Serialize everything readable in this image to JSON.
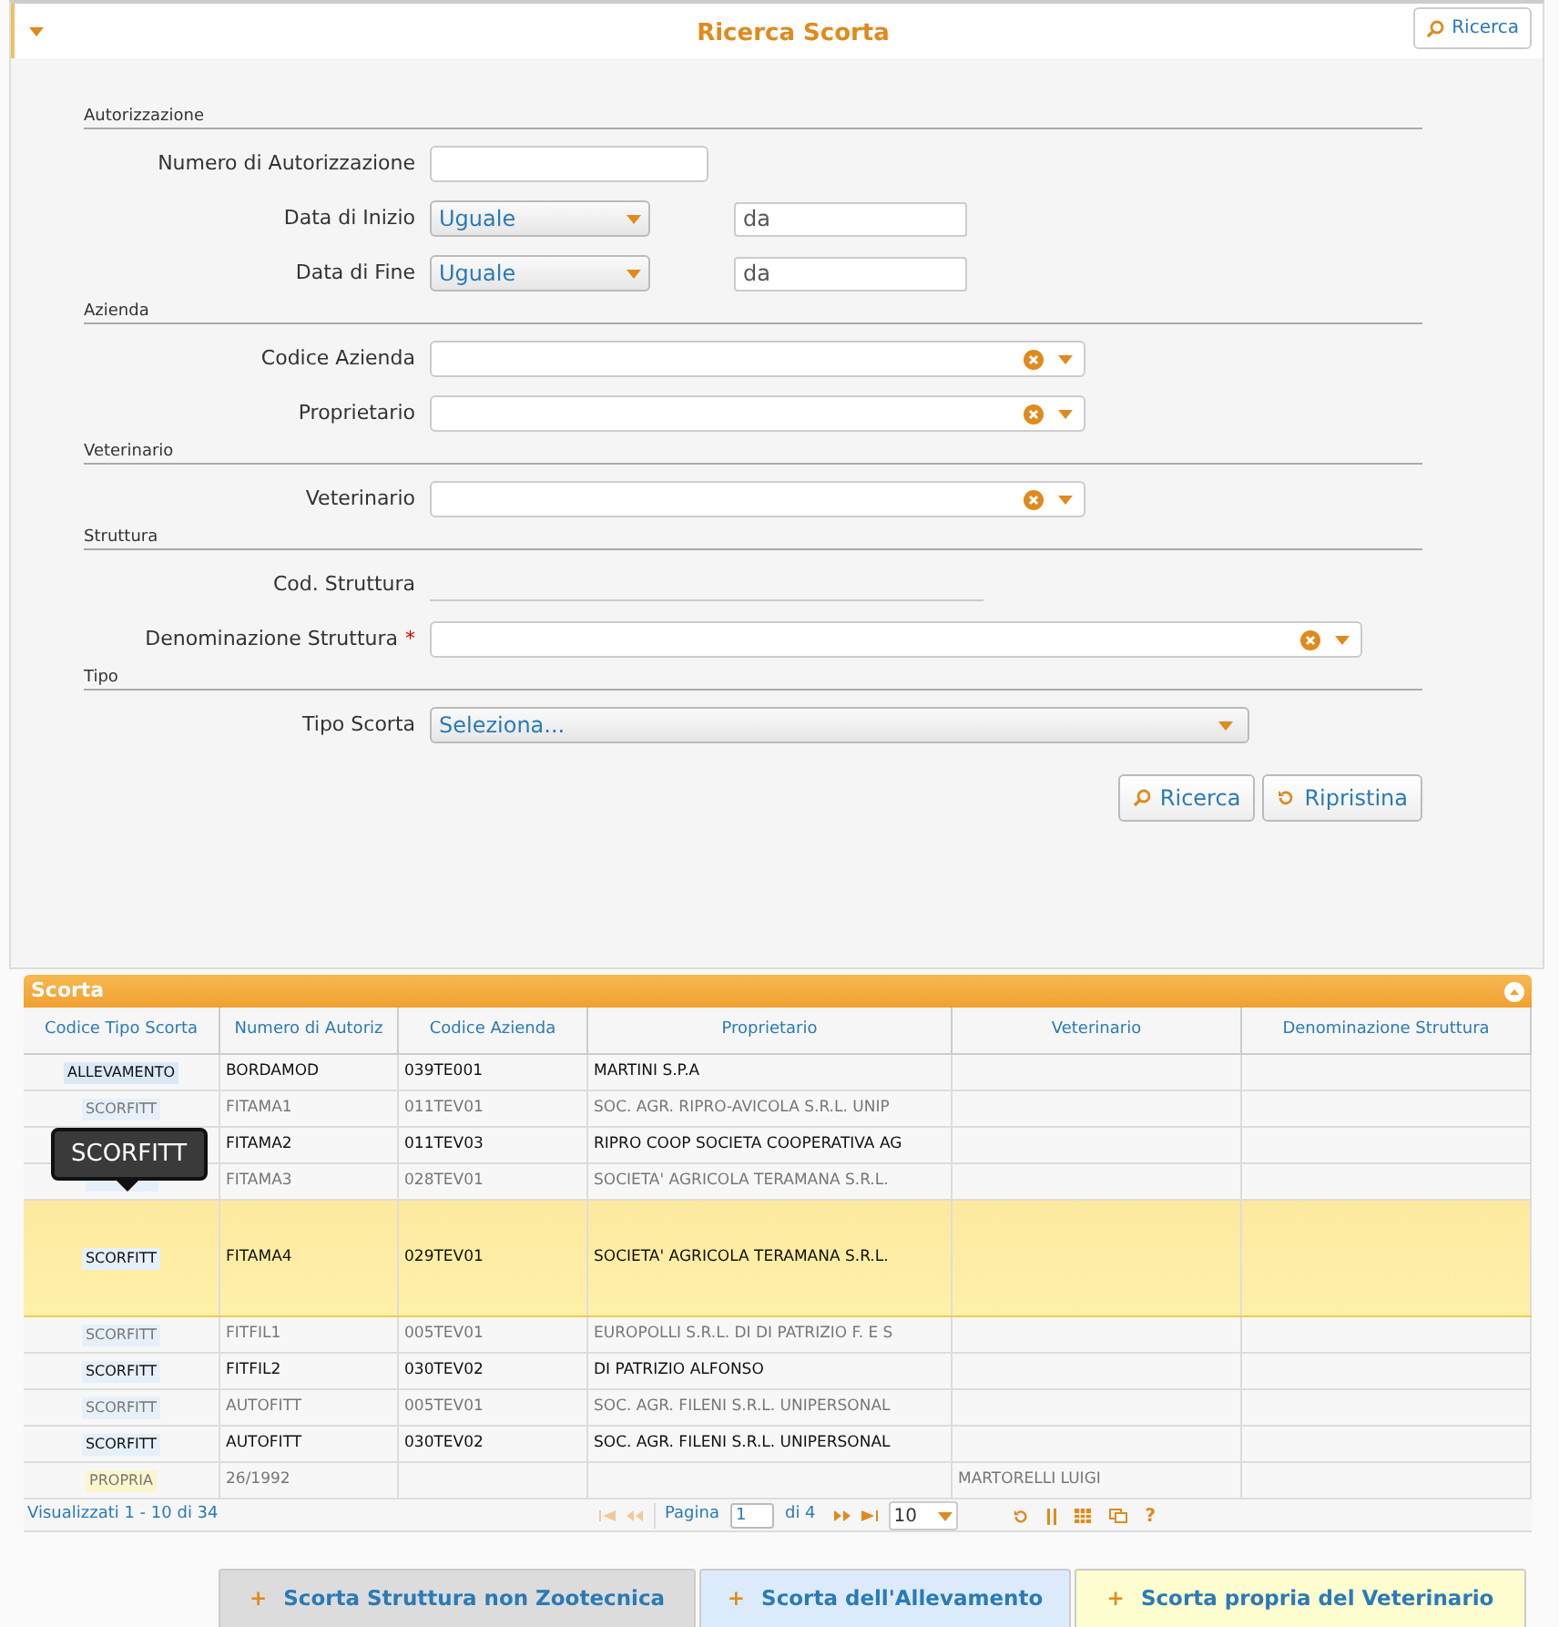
{
  "panel": {
    "title": "Ricerca Scorta",
    "header_button": "Ricerca"
  },
  "sections": [
    {
      "title": "Autorizzazione",
      "fields": [
        {
          "kind": "text",
          "label": "Numero di Autorizzazione"
        },
        {
          "kind": "date_filter",
          "label": "Data di Inizio",
          "operator": "Uguale",
          "placeholder": "da"
        },
        {
          "kind": "date_filter",
          "label": "Data di Fine",
          "operator": "Uguale",
          "placeholder": "da"
        }
      ]
    },
    {
      "title": "Azienda",
      "fields": [
        {
          "kind": "combo",
          "label": "Codice Azienda"
        },
        {
          "kind": "combo",
          "label": "Proprietario"
        }
      ]
    },
    {
      "title": "Veterinario",
      "fields": [
        {
          "kind": "combo",
          "label": "Veterinario"
        }
      ]
    },
    {
      "title": "Struttura",
      "fields": [
        {
          "kind": "readonly",
          "label": "Cod. Struttura"
        },
        {
          "kind": "combo_wide",
          "label": "Denominazione Struttura",
          "required_mark": "*"
        }
      ]
    },
    {
      "title": "Tipo",
      "fields": [
        {
          "kind": "select",
          "label": "Tipo Scorta",
          "value": "Seleziona..."
        }
      ]
    }
  ],
  "actions": [
    "Ricerca",
    "Ripristina"
  ],
  "grid": {
    "title": "Scorta",
    "columns": [
      "Codice Tipo Scorta",
      "Numero di Autoriz",
      "Codice Azienda",
      "Proprietario",
      "Veterinario",
      "Denominazione Struttura"
    ],
    "rows": [
      {
        "kind": "allevamento",
        "cells": [
          "ALLEVAMENTO",
          "BORDAMOD",
          "039TE001",
          "MARTINI S.P.A",
          "",
          ""
        ],
        "emphasized": true,
        "selected": false
      },
      {
        "kind": "scorfitt",
        "cells": [
          "SCORFITT",
          "FITAMA1",
          "011TEV01",
          "SOC. AGR. RIPRO-AVICOLA S.R.L. UNIP",
          "",
          ""
        ],
        "emphasized": false,
        "selected": false
      },
      {
        "cells": [
          "",
          "FITAMA2",
          "011TEV03",
          "RIPRO COOP SOCIETA COOPERATIVA AG",
          "",
          ""
        ],
        "emphasized": true,
        "selected": false
      },
      {
        "kind": "scorfitt",
        "cells": [
          "",
          "FITAMA3",
          "028TEV01",
          "SOCIETA' AGRICOLA TERAMANA S.R.L.",
          "",
          ""
        ],
        "emphasized": false,
        "selected": false
      },
      {
        "kind": "scorfitt",
        "cells": [
          "SCORFITT",
          "FITAMA4",
          "029TEV01",
          "SOCIETA' AGRICOLA TERAMANA S.R.L.",
          "",
          ""
        ],
        "emphasized": true,
        "selected": true
      },
      {
        "kind": "scorfitt",
        "cells": [
          "SCORFITT",
          "FITFIL1",
          "005TEV01",
          "EUROPOLLI S.R.L. DI DI PATRIZIO F. E S",
          "",
          ""
        ],
        "emphasized": false,
        "selected": false
      },
      {
        "kind": "scorfitt",
        "cells": [
          "SCORFITT",
          "FITFIL2",
          "030TEV02",
          "DI PATRIZIO ALFONSO",
          "",
          ""
        ],
        "emphasized": true,
        "selected": false
      },
      {
        "kind": "scorfitt",
        "cells": [
          "SCORFITT",
          "AUTOFITT",
          "005TEV01",
          "SOC. AGR. FILENI S.R.L. UNIPERSONAL",
          "",
          ""
        ],
        "emphasized": false,
        "selected": false
      },
      {
        "kind": "scorfitt",
        "cells": [
          "SCORFITT",
          "AUTOFITT",
          "030TEV02",
          "SOC. AGR. FILENI S.R.L. UNIPERSONAL",
          "",
          ""
        ],
        "emphasized": true,
        "selected": false
      },
      {
        "kind": "propria",
        "cells": [
          "PROPRIA",
          "26/1992",
          "",
          "",
          "MARTORELLI LUIGI",
          ""
        ],
        "emphasized": false,
        "selected": false
      }
    ],
    "tooltip": "SCORFITT",
    "pager": {
      "summary": "Visualizzati 1 - 10 di 34",
      "page_label": "Pagina",
      "page": "1",
      "of": "di 4",
      "page_size": "10",
      "help": "?"
    }
  },
  "buttons": [
    {
      "kind": "struttura",
      "label": "Scorta Struttura non Zootecnica",
      "plus": "+"
    },
    {
      "kind": "allevamento",
      "label": "Scorta dell'Allevamento",
      "plus": "+"
    },
    {
      "kind": "veterinario",
      "label": "Scorta propria del Veterinario",
      "plus": "+"
    }
  ]
}
